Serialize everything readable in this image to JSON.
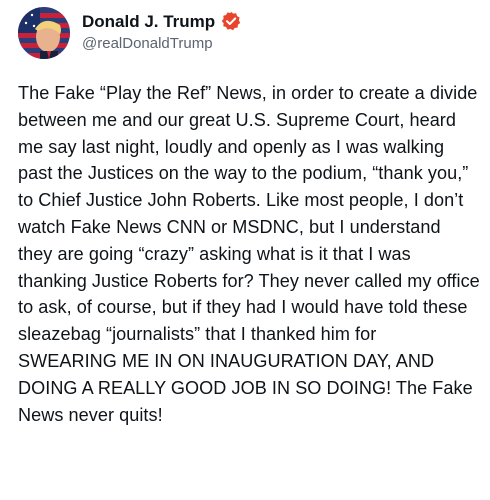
{
  "post": {
    "author": {
      "display_name": "Donald J. Trump",
      "handle": "@realDonaldTrump",
      "verified_icon": "verified-badge-icon",
      "avatar_icon": "avatar-image",
      "badge_color": "#e8442c"
    },
    "body": "The Fake “Play the Ref” News, in order to create a divide between me and our great U.S. Supreme Court, heard me say last night, loudly and openly as I was walking past the Justices on the way to the podium, “thank you,” to Chief Justice John Roberts. Like most people, I don’t watch Fake News CNN or MSDNC, but I understand they are going “crazy” asking what is it that I was thanking Justice Roberts for? They never called my office to ask, of course, but if they had I would have told these sleazebag “journalists” that I thanked him for SWEARING ME IN ON INAUGURATION DAY, AND DOING A REALLY GOOD JOB IN SO DOING! The Fake News never quits!"
  }
}
